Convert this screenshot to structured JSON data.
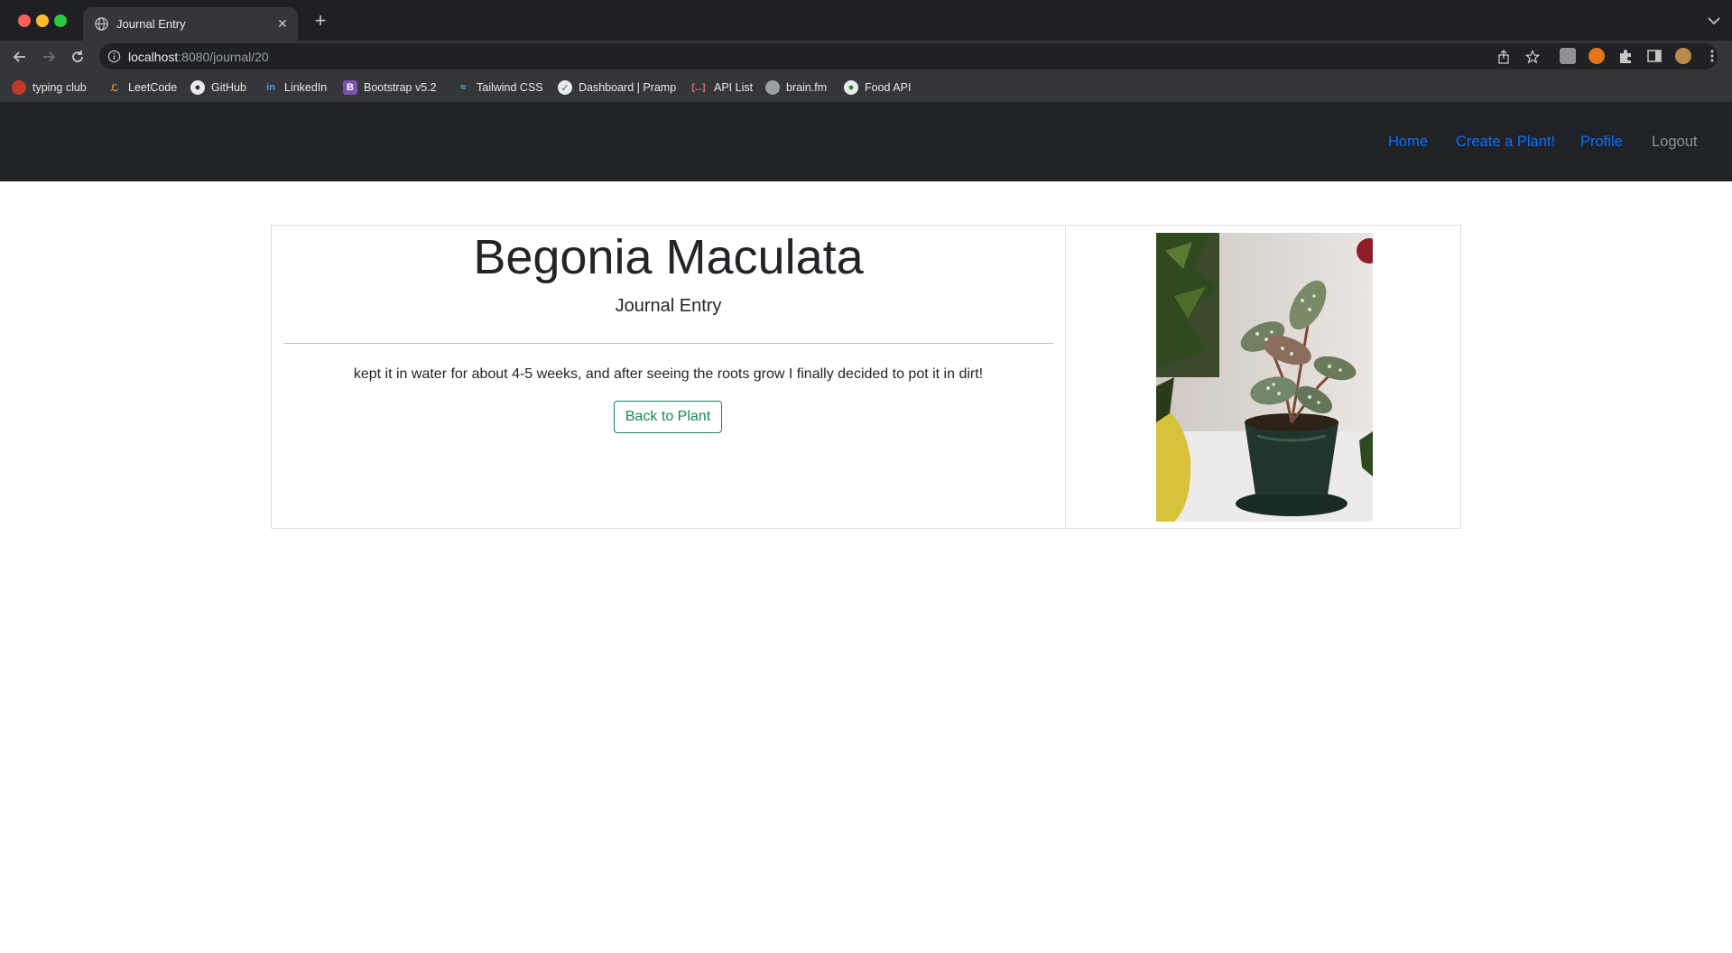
{
  "browser": {
    "tab_title": "Journal Entry",
    "url_host": "localhost",
    "url_path": ":8080/journal/20",
    "bookmarks": [
      {
        "label": "typing club",
        "icon": "typing-club-icon"
      },
      {
        "label": "LeetCode",
        "icon": "leetcode-icon"
      },
      {
        "label": "GitHub",
        "icon": "github-icon"
      },
      {
        "label": "LinkedIn",
        "icon": "linkedin-icon"
      },
      {
        "label": "Bootstrap v5.2",
        "icon": "bootstrap-icon"
      },
      {
        "label": "Tailwind CSS",
        "icon": "tailwind-icon"
      },
      {
        "label": "Dashboard | Pramp",
        "icon": "pramp-icon"
      },
      {
        "label": "API List",
        "icon": "brackets-icon"
      },
      {
        "label": "brain.fm",
        "icon": "brainfm-icon"
      },
      {
        "label": "Food API",
        "icon": "food-api-icon"
      }
    ]
  },
  "nav": {
    "home": "Home",
    "create": "Create a Plant!",
    "profile": "Profile",
    "logout": "Logout"
  },
  "entry": {
    "plant_name": "Begonia Maculata",
    "subtitle": "Journal Entry",
    "text": "kept it in water for about 4-5 weeks, and after seeing the roots grow I finally decided to pot it in dirt!",
    "back_button": "Back to Plant"
  },
  "colors": {
    "link": "#0d6efd",
    "success": "#198754",
    "navbar_bg": "#1f2327"
  }
}
